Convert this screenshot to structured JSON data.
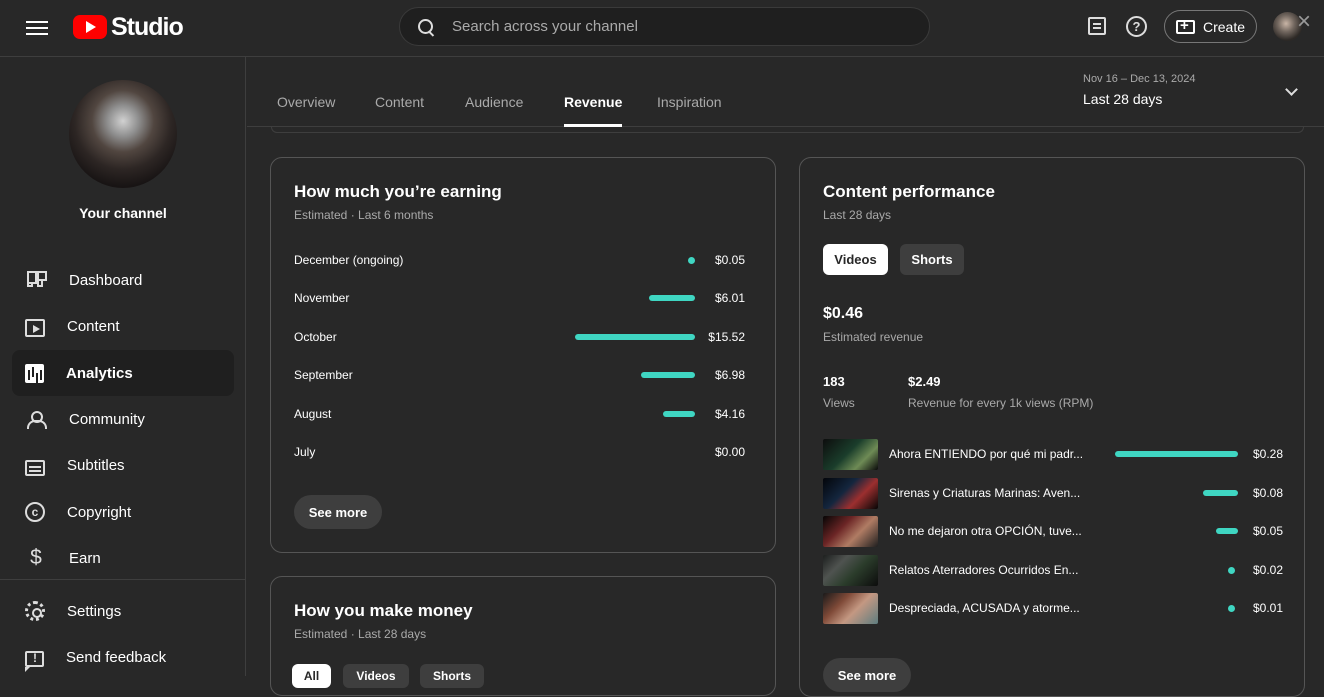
{
  "app": {
    "logo_text": "Studio",
    "search_placeholder": "Search across your channel",
    "create_label": "Create"
  },
  "sidebar": {
    "channel_label": "Your channel",
    "items": [
      {
        "label": "Dashboard",
        "icon": "dashboard-icon"
      },
      {
        "label": "Content",
        "icon": "content-icon"
      },
      {
        "label": "Analytics",
        "icon": "analytics-icon"
      },
      {
        "label": "Community",
        "icon": "community-icon"
      },
      {
        "label": "Subtitles",
        "icon": "subtitles-icon"
      },
      {
        "label": "Copyright",
        "icon": "copyright-icon"
      },
      {
        "label": "Earn",
        "icon": "earn-icon"
      }
    ],
    "bottom_items": [
      {
        "label": "Settings",
        "icon": "settings-icon"
      },
      {
        "label": "Send feedback",
        "icon": "feedback-icon"
      }
    ]
  },
  "tabs": [
    {
      "label": "Overview"
    },
    {
      "label": "Content"
    },
    {
      "label": "Audience"
    },
    {
      "label": "Revenue"
    },
    {
      "label": "Inspiration"
    }
  ],
  "date_range": {
    "dates": "Nov 16 – Dec 13, 2024",
    "label": "Last 28 days"
  },
  "earnings_card": {
    "title": "How much you’re earning",
    "subtitle": "Estimated · Last 6 months",
    "rows": [
      {
        "month": "December (ongoing)",
        "value": "$0.05",
        "amount": 0.05
      },
      {
        "month": "November",
        "value": "$6.01",
        "amount": 6.01
      },
      {
        "month": "October",
        "value": "$15.52",
        "amount": 15.52
      },
      {
        "month": "September",
        "value": "$6.98",
        "amount": 6.98
      },
      {
        "month": "August",
        "value": "$4.16",
        "amount": 4.16
      },
      {
        "month": "July",
        "value": "$0.00",
        "amount": 0.0
      }
    ],
    "see_more": "See more"
  },
  "money_card": {
    "title": "How you make money",
    "subtitle": "Estimated · Last 28 days",
    "buttons": [
      {
        "label": "All"
      },
      {
        "label": "Videos"
      },
      {
        "label": "Shorts"
      }
    ]
  },
  "performance_card": {
    "title": "Content performance",
    "subtitle": "Last 28 days",
    "toggles": [
      {
        "label": "Videos"
      },
      {
        "label": "Shorts"
      }
    ],
    "revenue": "$0.46",
    "revenue_label": "Estimated revenue",
    "views": "183",
    "views_label": "Views",
    "rpm": "$2.49",
    "rpm_label": "Revenue for every 1k views (RPM)",
    "videos": [
      {
        "title": "Ahora ENTIENDO por qué mi padr...",
        "value": "$0.28",
        "amount": 0.28
      },
      {
        "title": "Sirenas y Criaturas Marinas: Aven...",
        "value": "$0.08",
        "amount": 0.08
      },
      {
        "title": "No me dejaron otra OPCIÓN, tuve...",
        "value": "$0.05",
        "amount": 0.05
      },
      {
        "title": "Relatos Aterradores Ocurridos En...",
        "value": "$0.02",
        "amount": 0.02
      },
      {
        "title": "Despreciada, ACUSADA y atorme...",
        "value": "$0.01",
        "amount": 0.01
      }
    ],
    "see_more": "See more"
  },
  "colors": {
    "accent": "#3fd6c2",
    "background": "#282828",
    "youtube_red": "#ff0000"
  }
}
